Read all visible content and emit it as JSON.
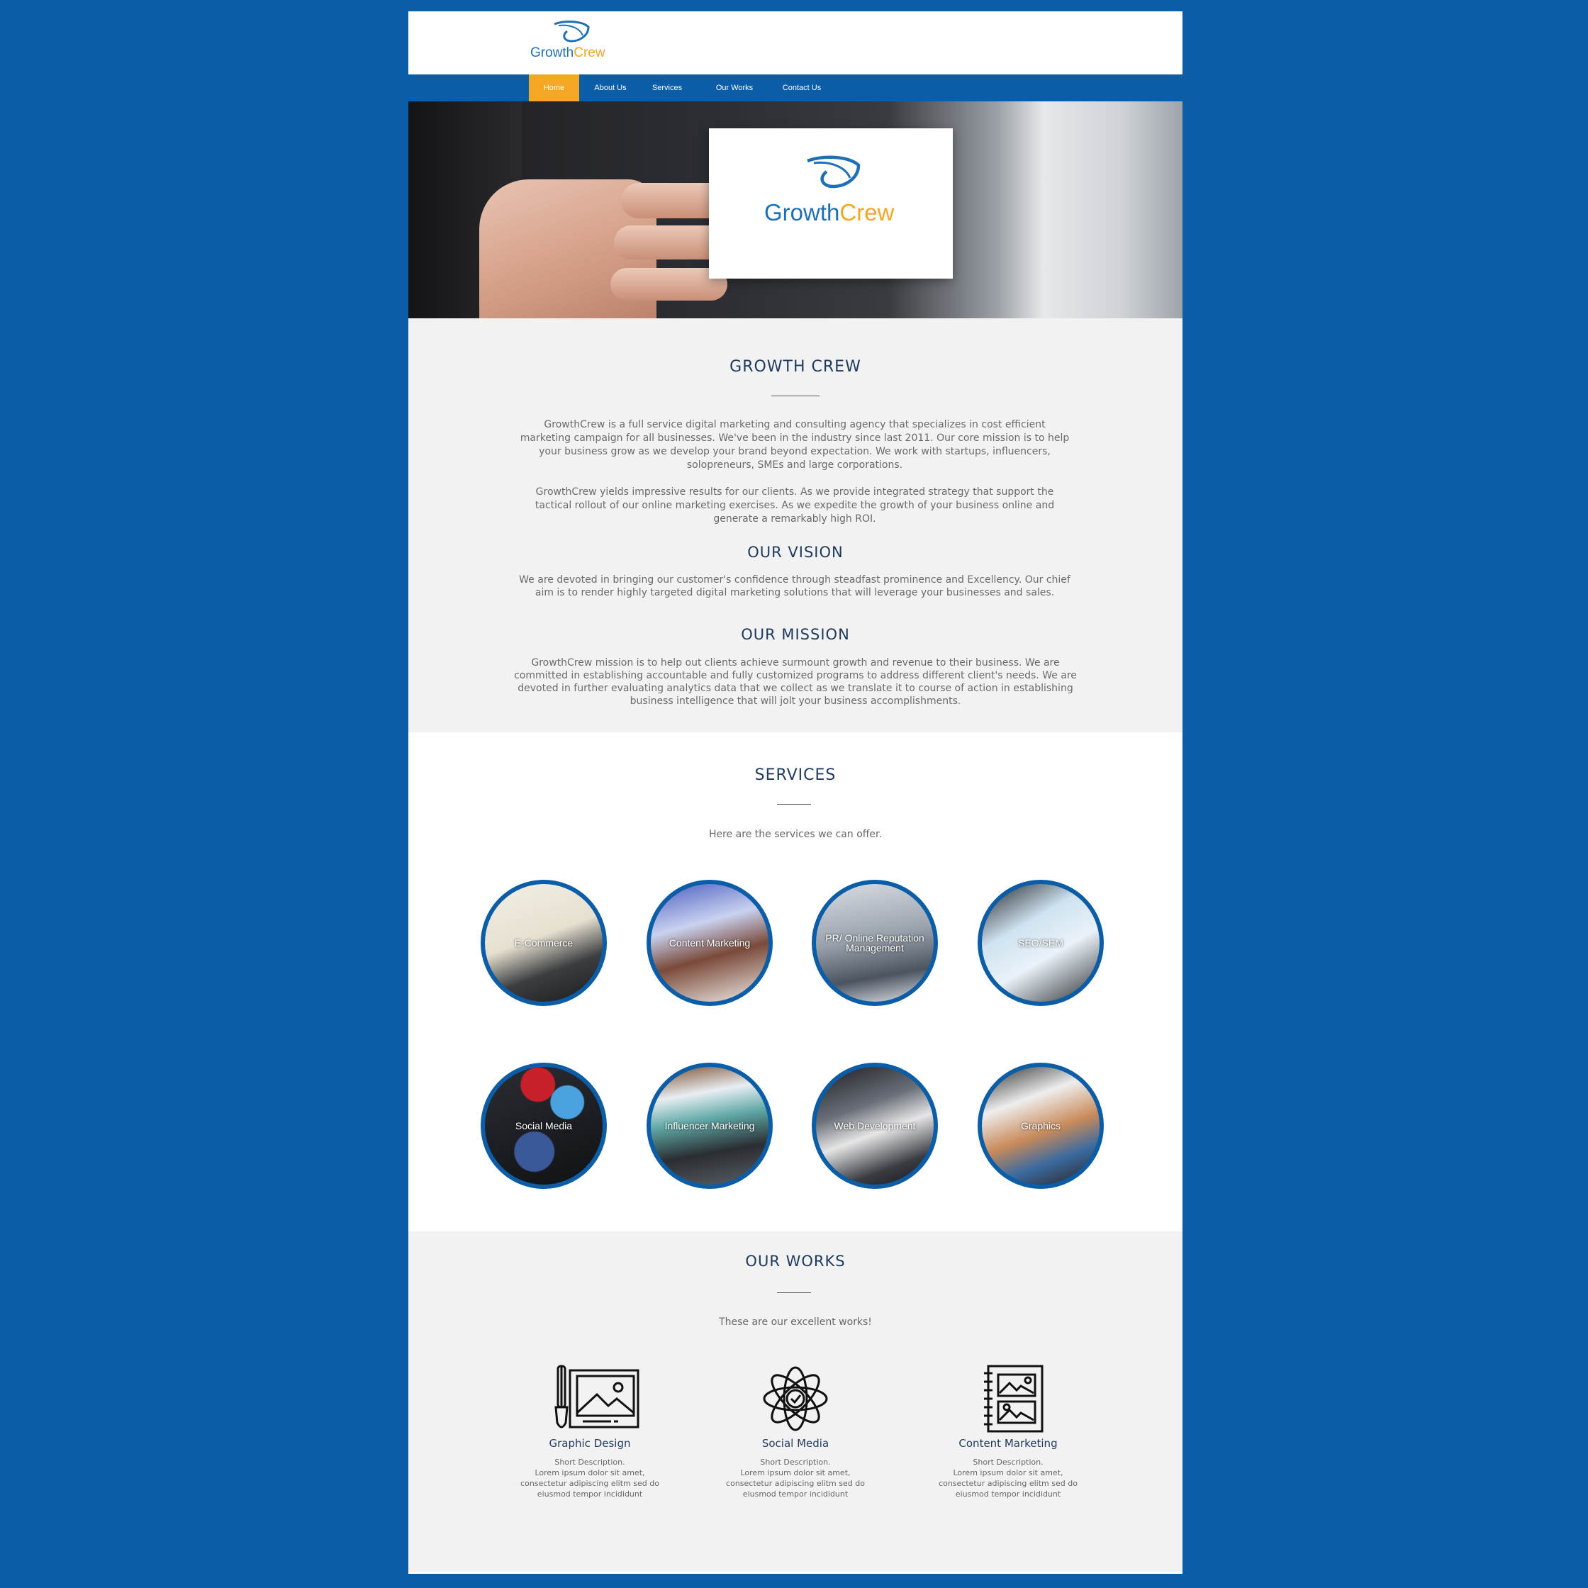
{
  "brand": {
    "part1": "Growth",
    "part2": "Crew"
  },
  "nav": {
    "items": [
      "Home",
      "About Us",
      "Services",
      "Our Works",
      "Contact Us"
    ]
  },
  "about": {
    "title": "GROWTH CREW",
    "para1": "GrowthCrew is a full service digital marketing and consulting agency that specializes in cost efficient marketing campaign for all businesses. We've been in the industry since last 2011. Our core mission is to help your business grow as we develop your brand beyond expectation. We work with startups, influencers, solopreneurs, SMEs and large corporations.",
    "para2": "GrowthCrew yields impressive results for our clients. As we provide integrated strategy that support the tactical rollout of our online marketing exercises. As we expedite the growth of your business online and generate a remarkably high ROI.",
    "vision_title": "OUR VISION",
    "vision_text": "We are devoted in bringing our customer's confidence through steadfast prominence and Excellency. Our chief aim is to render highly targeted digital marketing solutions that will leverage your businesses and sales.",
    "mission_title": "OUR MISSION",
    "mission_text": "GrowthCrew mission is to help out clients achieve surmount growth and revenue to their business. We are committed in establishing accountable and fully customized programs to address different client's needs. We are devoted in further evaluating analytics data that we collect as we translate it to course of action in establishing business intelligence that will jolt your business accomplishments."
  },
  "services": {
    "title": "SERVICES",
    "subtitle": "Here are the services we can offer.",
    "items": [
      {
        "label": "E-Commerce",
        "icon": "laptop-chart-image"
      },
      {
        "label": "Content Marketing",
        "icon": "laptop-desk-image"
      },
      {
        "label": "PR/ Online Reputation Management",
        "icon": "tablet-hands-image"
      },
      {
        "label": "SEO/SEM",
        "icon": "tablet-analytics-image"
      },
      {
        "label": "Social Media",
        "icon": "social-apps-image"
      },
      {
        "label": "Influencer Marketing",
        "icon": "laptop-dashboard-image"
      },
      {
        "label": "Web Development",
        "icon": "monitor-website-image"
      },
      {
        "label": "Graphics",
        "icon": "photo-prints-image"
      }
    ]
  },
  "works": {
    "title": "OUR WORKS",
    "subtitle": "These are our excellent works!",
    "items": [
      {
        "title": "Graphic Design",
        "icon": "brush-canvas-icon",
        "desc": [
          "Short Description.",
          "Lorem ipsum dolor sit amet,",
          "consectetur adipiscing elitm sed do",
          "eiusmod tempor incididunt"
        ]
      },
      {
        "title": "Social Media",
        "icon": "network-flower-icon",
        "desc": [
          "Short Description.",
          "Lorem ipsum dolor sit amet,",
          "consectetur adipiscing elitm sed do",
          "eiusmod tempor incididunt"
        ]
      },
      {
        "title": "Content Marketing",
        "icon": "notebook-images-icon",
        "desc": [
          "Short Description.",
          "Lorem ipsum dolor sit amet,",
          "consectetur adipiscing elitm sed do",
          "eiusmod tempor incididunt"
        ]
      }
    ]
  },
  "colors": {
    "brand_blue": "#0a5da6",
    "accent_orange": "#f5a623",
    "heading": "#1d3a5c"
  }
}
